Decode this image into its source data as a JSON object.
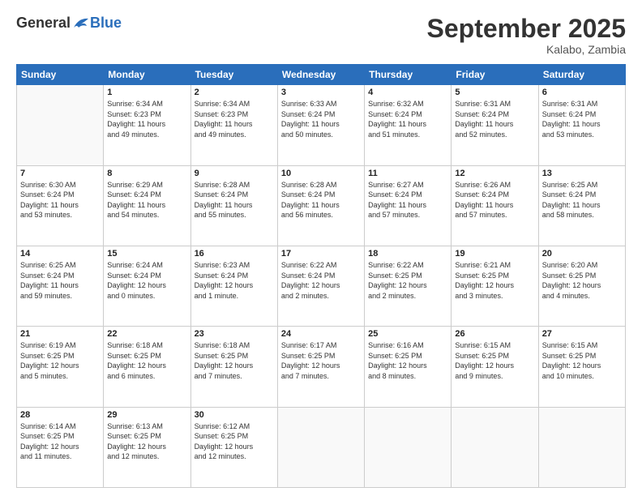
{
  "header": {
    "logo_general": "General",
    "logo_blue": "Blue",
    "month_title": "September 2025",
    "subtitle": "Kalabo, Zambia"
  },
  "weekdays": [
    "Sunday",
    "Monday",
    "Tuesday",
    "Wednesday",
    "Thursday",
    "Friday",
    "Saturday"
  ],
  "weeks": [
    [
      {
        "day": "",
        "info": ""
      },
      {
        "day": "1",
        "info": "Sunrise: 6:34 AM\nSunset: 6:23 PM\nDaylight: 11 hours\nand 49 minutes."
      },
      {
        "day": "2",
        "info": "Sunrise: 6:34 AM\nSunset: 6:23 PM\nDaylight: 11 hours\nand 49 minutes."
      },
      {
        "day": "3",
        "info": "Sunrise: 6:33 AM\nSunset: 6:24 PM\nDaylight: 11 hours\nand 50 minutes."
      },
      {
        "day": "4",
        "info": "Sunrise: 6:32 AM\nSunset: 6:24 PM\nDaylight: 11 hours\nand 51 minutes."
      },
      {
        "day": "5",
        "info": "Sunrise: 6:31 AM\nSunset: 6:24 PM\nDaylight: 11 hours\nand 52 minutes."
      },
      {
        "day": "6",
        "info": "Sunrise: 6:31 AM\nSunset: 6:24 PM\nDaylight: 11 hours\nand 53 minutes."
      }
    ],
    [
      {
        "day": "7",
        "info": "Sunrise: 6:30 AM\nSunset: 6:24 PM\nDaylight: 11 hours\nand 53 minutes."
      },
      {
        "day": "8",
        "info": "Sunrise: 6:29 AM\nSunset: 6:24 PM\nDaylight: 11 hours\nand 54 minutes."
      },
      {
        "day": "9",
        "info": "Sunrise: 6:28 AM\nSunset: 6:24 PM\nDaylight: 11 hours\nand 55 minutes."
      },
      {
        "day": "10",
        "info": "Sunrise: 6:28 AM\nSunset: 6:24 PM\nDaylight: 11 hours\nand 56 minutes."
      },
      {
        "day": "11",
        "info": "Sunrise: 6:27 AM\nSunset: 6:24 PM\nDaylight: 11 hours\nand 57 minutes."
      },
      {
        "day": "12",
        "info": "Sunrise: 6:26 AM\nSunset: 6:24 PM\nDaylight: 11 hours\nand 57 minutes."
      },
      {
        "day": "13",
        "info": "Sunrise: 6:25 AM\nSunset: 6:24 PM\nDaylight: 11 hours\nand 58 minutes."
      }
    ],
    [
      {
        "day": "14",
        "info": "Sunrise: 6:25 AM\nSunset: 6:24 PM\nDaylight: 11 hours\nand 59 minutes."
      },
      {
        "day": "15",
        "info": "Sunrise: 6:24 AM\nSunset: 6:24 PM\nDaylight: 12 hours\nand 0 minutes."
      },
      {
        "day": "16",
        "info": "Sunrise: 6:23 AM\nSunset: 6:24 PM\nDaylight: 12 hours\nand 1 minute."
      },
      {
        "day": "17",
        "info": "Sunrise: 6:22 AM\nSunset: 6:24 PM\nDaylight: 12 hours\nand 2 minutes."
      },
      {
        "day": "18",
        "info": "Sunrise: 6:22 AM\nSunset: 6:25 PM\nDaylight: 12 hours\nand 2 minutes."
      },
      {
        "day": "19",
        "info": "Sunrise: 6:21 AM\nSunset: 6:25 PM\nDaylight: 12 hours\nand 3 minutes."
      },
      {
        "day": "20",
        "info": "Sunrise: 6:20 AM\nSunset: 6:25 PM\nDaylight: 12 hours\nand 4 minutes."
      }
    ],
    [
      {
        "day": "21",
        "info": "Sunrise: 6:19 AM\nSunset: 6:25 PM\nDaylight: 12 hours\nand 5 minutes."
      },
      {
        "day": "22",
        "info": "Sunrise: 6:18 AM\nSunset: 6:25 PM\nDaylight: 12 hours\nand 6 minutes."
      },
      {
        "day": "23",
        "info": "Sunrise: 6:18 AM\nSunset: 6:25 PM\nDaylight: 12 hours\nand 7 minutes."
      },
      {
        "day": "24",
        "info": "Sunrise: 6:17 AM\nSunset: 6:25 PM\nDaylight: 12 hours\nand 7 minutes."
      },
      {
        "day": "25",
        "info": "Sunrise: 6:16 AM\nSunset: 6:25 PM\nDaylight: 12 hours\nand 8 minutes."
      },
      {
        "day": "26",
        "info": "Sunrise: 6:15 AM\nSunset: 6:25 PM\nDaylight: 12 hours\nand 9 minutes."
      },
      {
        "day": "27",
        "info": "Sunrise: 6:15 AM\nSunset: 6:25 PM\nDaylight: 12 hours\nand 10 minutes."
      }
    ],
    [
      {
        "day": "28",
        "info": "Sunrise: 6:14 AM\nSunset: 6:25 PM\nDaylight: 12 hours\nand 11 minutes."
      },
      {
        "day": "29",
        "info": "Sunrise: 6:13 AM\nSunset: 6:25 PM\nDaylight: 12 hours\nand 12 minutes."
      },
      {
        "day": "30",
        "info": "Sunrise: 6:12 AM\nSunset: 6:25 PM\nDaylight: 12 hours\nand 12 minutes."
      },
      {
        "day": "",
        "info": ""
      },
      {
        "day": "",
        "info": ""
      },
      {
        "day": "",
        "info": ""
      },
      {
        "day": "",
        "info": ""
      }
    ]
  ]
}
